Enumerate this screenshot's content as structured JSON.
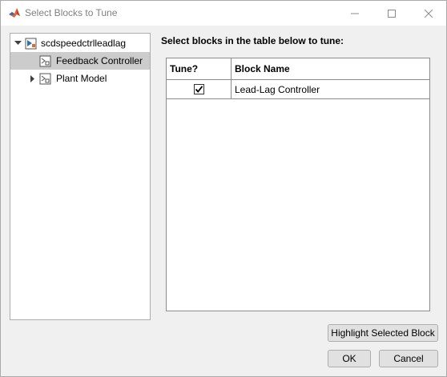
{
  "window": {
    "title": "Select Blocks to Tune",
    "icon": "matlab-logo-icon",
    "controls": [
      "minimize-icon",
      "maximize-icon",
      "close-icon"
    ]
  },
  "tree": {
    "root": {
      "label": "scdspeedctrlleadlag",
      "expanded": true,
      "icon": "model-block-icon"
    },
    "children": [
      {
        "label": "Feedback Controller",
        "selected": true,
        "icon": "subsystem-icon"
      },
      {
        "label": "Plant Model",
        "selected": false,
        "expanded": false,
        "icon": "subsystem-icon"
      }
    ]
  },
  "main": {
    "instruction": "Select blocks in the table below to tune:",
    "table": {
      "columns": [
        "Tune?",
        "Block Name"
      ],
      "rows": [
        {
          "tune": true,
          "block_name": "Lead-Lag Controller"
        }
      ]
    }
  },
  "buttons": {
    "highlight": "Highlight Selected Block",
    "ok": "OK",
    "cancel": "Cancel"
  },
  "colors": {
    "selection": "#cccccc",
    "matlab_orange": "#e16737"
  }
}
